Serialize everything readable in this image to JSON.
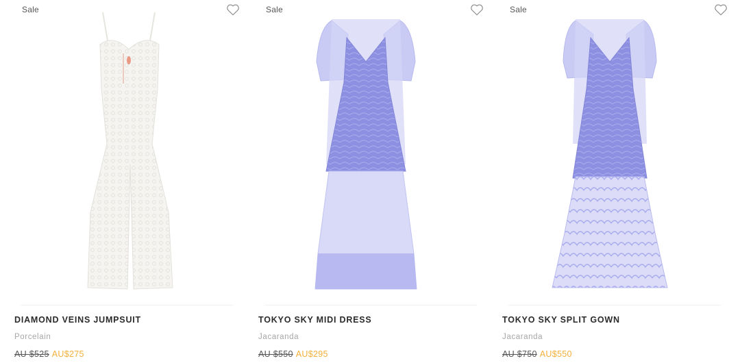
{
  "products": [
    {
      "badge": "Sale",
      "name": "DIAMOND VEINS JUMPSUIT",
      "color": "Porcelain",
      "price_old": "AU $525",
      "price_new": "AU$275",
      "image_icon": "white-lace-jumpsuit-image",
      "swatch": "#f4f3ef"
    },
    {
      "badge": "Sale",
      "name": "TOKYO SKY MIDI DRESS",
      "color": "Jacaranda",
      "price_old": "AU $550",
      "price_new": "AU$295",
      "image_icon": "blue-ruffle-midi-dress-image",
      "swatch": "#8f92e0"
    },
    {
      "badge": "Sale",
      "name": "TOKYO SKY SPLIT GOWN",
      "color": "Jacaranda",
      "price_old": "AU $750",
      "price_new": "AU$550",
      "image_icon": "blue-ruffle-split-gown-image",
      "swatch": "#8f92e0"
    }
  ],
  "colors": {
    "sale_price": "#f3b03a",
    "muted": "#a7a7a7"
  },
  "icons": {
    "wishlist": "heart-outline-icon"
  }
}
